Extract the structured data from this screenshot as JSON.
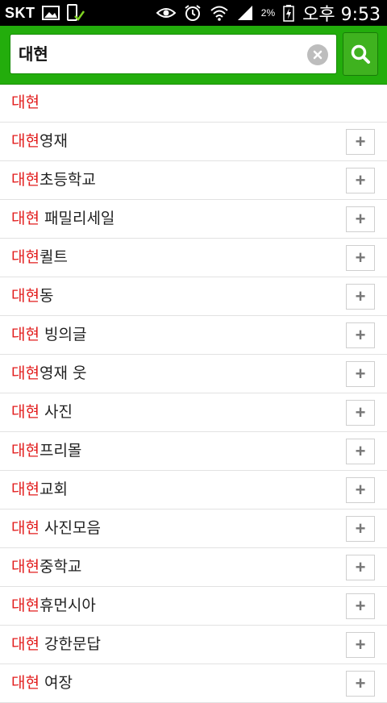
{
  "status_bar": {
    "carrier": "SKT",
    "battery_percent": "2%",
    "clock": "오후 9:53"
  },
  "search": {
    "query": "대현",
    "clear_icon": "clear-icon",
    "search_icon": "search-icon"
  },
  "suggestions": [
    {
      "prefix": "대현",
      "suffix": "",
      "has_add": false
    },
    {
      "prefix": "대현",
      "suffix": "영재",
      "has_add": true
    },
    {
      "prefix": "대현",
      "suffix": "초등학교",
      "has_add": true
    },
    {
      "prefix": "대현",
      "suffix": " 패밀리세일",
      "has_add": true
    },
    {
      "prefix": "대현",
      "suffix": "퀼트",
      "has_add": true
    },
    {
      "prefix": "대현",
      "suffix": "동",
      "has_add": true
    },
    {
      "prefix": "대현",
      "suffix": " 빙의글",
      "has_add": true
    },
    {
      "prefix": "대현",
      "suffix": "영재 웃",
      "has_add": true
    },
    {
      "prefix": "대현",
      "suffix": " 사진",
      "has_add": true
    },
    {
      "prefix": "대현",
      "suffix": "프리몰",
      "has_add": true
    },
    {
      "prefix": "대현",
      "suffix": "교회",
      "has_add": true
    },
    {
      "prefix": "대현",
      "suffix": " 사진모음",
      "has_add": true
    },
    {
      "prefix": "대현",
      "suffix": "중학교",
      "has_add": true
    },
    {
      "prefix": "대현",
      "suffix": "휴먼시아",
      "has_add": true
    },
    {
      "prefix": "대현",
      "suffix": " 강한문답",
      "has_add": true
    },
    {
      "prefix": "대현",
      "suffix": " 여장",
      "has_add": true
    }
  ],
  "add_button_label": "+",
  "colors": {
    "accent_green": "#23ad0c",
    "highlight_red": "#e21d1d"
  }
}
